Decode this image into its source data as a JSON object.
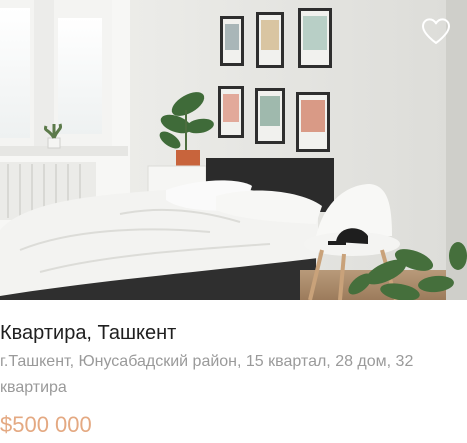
{
  "listing": {
    "title": "Квартира, Ташкент",
    "address": "г.Ташкент, Юнусабадский район, 15 квартал, 28 дом, 32 квартира",
    "price": "$500 000",
    "favorite_icon": "heart-outline-icon"
  },
  "colors": {
    "price": "#e4a982",
    "title": "#1f1f1f",
    "address": "#9a9a9a",
    "icon": "#ffffff"
  }
}
